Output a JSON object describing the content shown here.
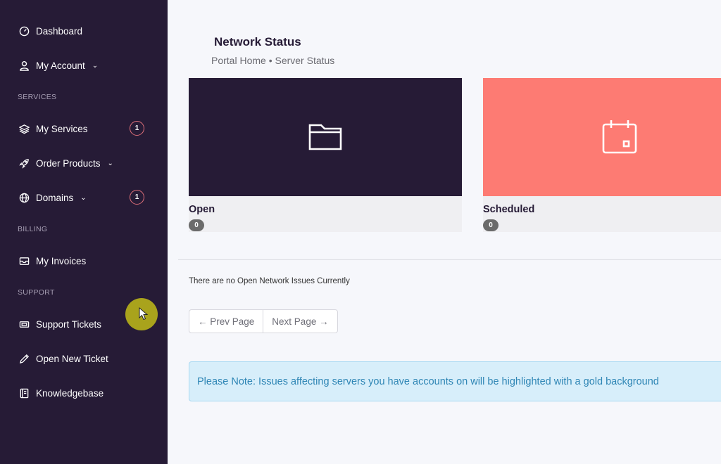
{
  "sidebar": {
    "items": [
      {
        "label": "Dashboard",
        "icon": "gauge-icon"
      },
      {
        "label": "My Account",
        "icon": "user-icon"
      },
      {
        "label": "My Services",
        "icon": "layers-icon",
        "badge": "1"
      },
      {
        "label": "Order Products",
        "icon": "rocket-icon"
      },
      {
        "label": "Domains",
        "icon": "globe-icon",
        "badge": "1"
      },
      {
        "label": "My Invoices",
        "icon": "envelope-icon"
      },
      {
        "label": "Support Tickets",
        "icon": "ticket-icon"
      },
      {
        "label": "Open New Ticket",
        "icon": "pencil-icon"
      },
      {
        "label": "Knowledgebase",
        "icon": "book-icon"
      }
    ],
    "sections": {
      "services": "SERVICES",
      "billing": "BILLING",
      "support": "SUPPORT"
    }
  },
  "header": {
    "title": "Network Status",
    "breadcrumb": "Portal Home • Server Status"
  },
  "cards": [
    {
      "label": "Open",
      "count": "0",
      "icon": "folder-icon",
      "color": "#261b36"
    },
    {
      "label": "Scheduled",
      "count": "0",
      "icon": "calendar-icon",
      "color": "#fd7b73"
    }
  ],
  "messages": {
    "no_issues": "There are no Open Network Issues Currently",
    "note": "Please Note: Issues affecting servers you have accounts on will be highlighted with a gold background"
  },
  "pager": {
    "prev": "← Prev Page",
    "next": "Next Page →"
  },
  "colors": {
    "sidebar": "#261b36",
    "accent": "#fd7b73",
    "badge_ring": "#e0707a",
    "info_bg": "#d7eefa"
  }
}
